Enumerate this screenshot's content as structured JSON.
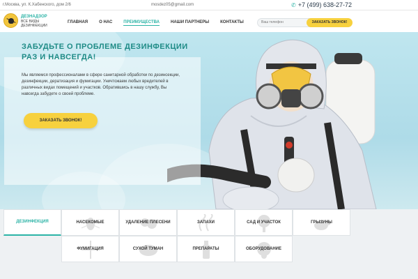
{
  "topbar": {
    "address": "г.Москва, ул. К.Хабенского, дом 2/6",
    "email": "mosdez05@gmail.com",
    "phone": "+7 (499) 638-27-72"
  },
  "logo": {
    "title": "ДЕЗНАДЗОР",
    "subtitle": "ВСЕ ВИДЫ ДЕЗИНФЕКЦИИ"
  },
  "nav": [
    {
      "label": "ГЛАВНАЯ"
    },
    {
      "label": "О НАС"
    },
    {
      "label": "ПРЕИМУЩЕСТВА"
    },
    {
      "label": "НАШИ ПАРТНЕРЫ"
    },
    {
      "label": "КОНТАКТЫ"
    }
  ],
  "callback_form": {
    "placeholder": "Ваш телефон",
    "button_label": "ЗАКАЗАТЬ ЗВОНОК!"
  },
  "hero": {
    "title": "ЗАБУДЬТЕ О ПРОБЛЕМЕ ДЕЗИНФЕКЦИИ РАЗ И НАВСЕГДА!",
    "text": "Мы являемся профессионалами в сфере санитарной обработки по дезинсекции, дезинфекции, дератизация и фумигации. Уничтожаем любых вредителей в различных видах помещений и участков. Обратившись в нашу службу, Вы навсегда забудете о своей проблеме.",
    "button_label": "ЗАКАЗАТЬ ЗВОНОК!"
  },
  "services": [
    {
      "label": "ДЕЗИНФЕКЦИЯ"
    },
    {
      "label": "НАСЕКОМЫЕ"
    },
    {
      "label": "УДАЛЕНИЕ ПЛЕСЕНИ"
    },
    {
      "label": "ЗАПАХИ"
    },
    {
      "label": "САД И УЧАСТОК"
    },
    {
      "label": "ГРЫЗУНЫ"
    },
    {
      "label": "ФУМИГАЦИЯ"
    },
    {
      "label": "СУХОЙ ТУМАН"
    },
    {
      "label": "ПРЕПАРАТЫ"
    },
    {
      "label": "ОБОРУДОВАНИЕ"
    }
  ],
  "colors": {
    "accent": "#2bb3a6",
    "button": "#f7d13e"
  },
  "icons": [
    "phone-icon",
    "logo-bug-icon"
  ]
}
